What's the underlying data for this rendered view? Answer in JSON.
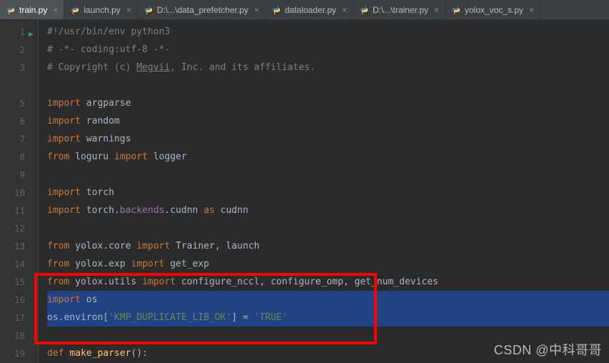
{
  "tabs": [
    {
      "label": "train.py",
      "active": true
    },
    {
      "label": "launch.py",
      "active": false
    },
    {
      "label": "D:\\...\\data_prefetcher.py",
      "active": false
    },
    {
      "label": "dataloader.py",
      "active": false
    },
    {
      "label": "D:\\...\\trainer.py",
      "active": false
    },
    {
      "label": "yolox_voc_s.py",
      "active": false
    }
  ],
  "gutter": [
    "1",
    "2",
    "3",
    "",
    "5",
    "6",
    "7",
    "8",
    "9",
    "10",
    "11",
    "12",
    "13",
    "14",
    "15",
    "16",
    "17",
    "18",
    "19"
  ],
  "code": {
    "l1": "#!/usr/bin/env python3",
    "l2": "# -*- coding:utf-8 -*-",
    "l3a": "# Copyright (c) ",
    "l3b": "Megvii",
    "l3c": ", Inc. and its affiliates.",
    "l5a": "import ",
    "l5b": "argparse",
    "l6a": "import ",
    "l6b": "random",
    "l7a": "import ",
    "l7b": "warnings",
    "l8a": "from ",
    "l8b": "loguru ",
    "l8c": "import ",
    "l8d": "logger",
    "l10a": "import ",
    "l10b": "torch",
    "l11a": "import ",
    "l11b": "torch.",
    "l11c": "backends",
    "l11d": ".cudnn ",
    "l11e": "as ",
    "l11f": "cudnn",
    "l13a": "from ",
    "l13b": "yolox.core ",
    "l13c": "import ",
    "l13d": "Trainer",
    "l13e": ", ",
    "l13f": "launch",
    "l14a": "from ",
    "l14b": "yolox.exp ",
    "l14c": "import ",
    "l14d": "get_exp",
    "l15a": "from ",
    "l15b": "yolox.utils ",
    "l15c": "import ",
    "l15d": "configure_nccl",
    "l15e": ", ",
    "l15f": "configure_omp",
    "l15g": ", ",
    "l15h": "get_num_devices",
    "l16a": "import ",
    "l16b": "os",
    "l17a": "os.environ[",
    "l17b": "'KMP_DUPLICATE_LIB_OK'",
    "l17c": "] = ",
    "l17d": "'TRUE'",
    "l19a": "def ",
    "l19b": "make_parser",
    "l19c": "():"
  },
  "highlight_box": {
    "top_line": 15,
    "bottom_line": 18
  },
  "watermark": "CSDN @中科哥哥"
}
